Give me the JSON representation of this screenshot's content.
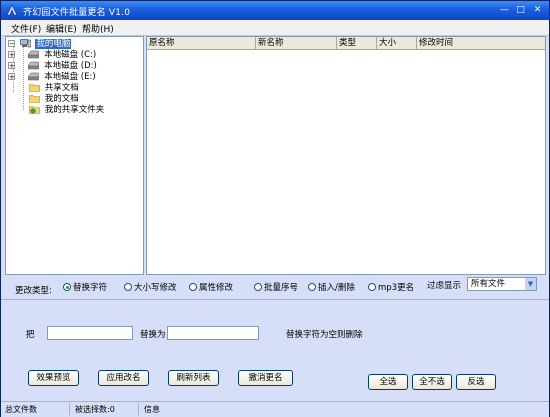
{
  "window": {
    "title": "齐幻园文件批量更名 V1.0",
    "min": "—",
    "max": "□",
    "close": "✕"
  },
  "menu": {
    "items": [
      {
        "label": "文件(F)"
      },
      {
        "label": "编辑(E)"
      },
      {
        "label": "帮助(H)"
      }
    ]
  },
  "tree": {
    "root": "我的电脑",
    "items": [
      {
        "label": "本地磁盘 (C:)",
        "icon": "drive-icon"
      },
      {
        "label": "本地磁盘 (D:)",
        "icon": "drive-icon"
      },
      {
        "label": "本地磁盘 (E:)",
        "icon": "drive-icon"
      },
      {
        "label": "共享文档",
        "icon": "folder-icon"
      },
      {
        "label": "我的文档",
        "icon": "folder-icon"
      },
      {
        "label": "我的共享文件夹",
        "icon": "shared-folder-icon"
      }
    ],
    "expand_symbol": "+"
  },
  "list": {
    "columns": [
      "原名称",
      "新名称",
      "类型",
      "大小",
      "修改时间"
    ]
  },
  "options": {
    "label": "更改类型:",
    "radios": [
      {
        "label": "替换字符",
        "checked": true
      },
      {
        "label": "大小写修改",
        "checked": false
      },
      {
        "label": "属性修改",
        "checked": false
      },
      {
        "label": "批量序号",
        "checked": false
      },
      {
        "label": "插入/删除",
        "checked": false
      },
      {
        "label": "mp3更名",
        "checked": false
      }
    ],
    "filter_label": "过虑显示",
    "filter_value": "所有文件",
    "filter_arrow": "▼"
  },
  "replace": {
    "from_label": "把",
    "to_label": "替换为",
    "hint": "替换字符为空则删除",
    "from_value": "",
    "to_value": ""
  },
  "buttons": {
    "preview": "效果预览",
    "apply": "应用改名",
    "refresh": "刷新列表",
    "undo": "撤消更名",
    "select_all": "全选",
    "select_none": "全不选",
    "invert": "反选"
  },
  "status": {
    "total": "总文件数",
    "selected": "被选择数:0",
    "info": "信息"
  },
  "colors": {
    "titlebar": "#1a5fe0",
    "background": "#d6dff7",
    "selection": "#316ac5"
  }
}
